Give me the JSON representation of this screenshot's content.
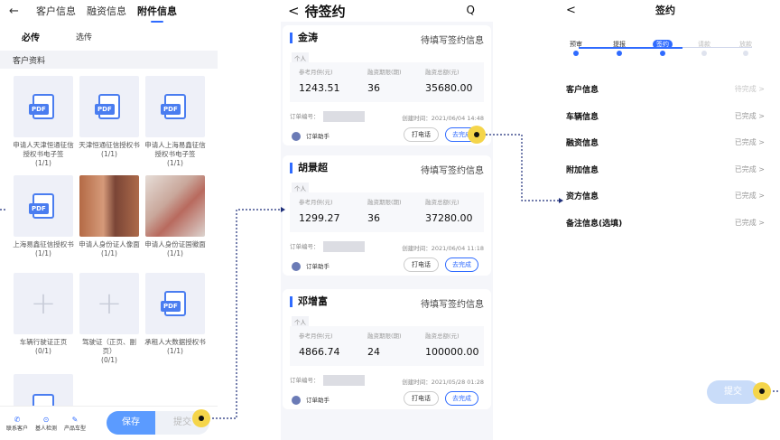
{
  "panel1": {
    "back": "←",
    "tabs": [
      "客户信息",
      "融资信息",
      "附件信息"
    ],
    "sub_tabs": [
      "必传",
      "选传"
    ],
    "section": "客户资料",
    "items": [
      {
        "label": "申请人天津恒通征信授权书电子签",
        "count": "(1/1)"
      },
      {
        "label": "天津恒通征信授权书",
        "count": "(1/1)"
      },
      {
        "label": "申请人上海易鑫征信授权书电子签",
        "count": "(1/1)"
      },
      {
        "label": "上海易鑫征信授权书",
        "count": "(1/1)"
      },
      {
        "label": "申请人身份证人像面",
        "count": "(1/1)"
      },
      {
        "label": "申请人身份证国徽面",
        "count": "(1/1)"
      },
      {
        "label": "车辆行驶证正页",
        "count": "(0/1)"
      },
      {
        "label": "驾驶证（正页、副页）",
        "count": "(0/1)"
      },
      {
        "label": "承租人大数据授权书",
        "count": "(1/1)"
      }
    ],
    "pdf_label": "PDF",
    "bottom": {
      "icons": [
        {
          "icon": "✆",
          "label": "联系客户"
        },
        {
          "icon": "⊙",
          "label": "基人检测"
        },
        {
          "icon": "✎",
          "label": "产品车型"
        }
      ],
      "save": "保存",
      "submit": "提交"
    }
  },
  "panel2": {
    "back": "<",
    "title": "待签约",
    "search_icon": "Q",
    "columns": [
      "参考月供(元)",
      "融资期限(期)",
      "融资总额(元)"
    ],
    "order_label": "订单编号：",
    "agent": "订单助手",
    "call": "打电话",
    "go": "去完成",
    "cards": [
      {
        "name": "金涛",
        "status": "待填写签约信息",
        "type": "个人",
        "monthly": "1243.51",
        "term": "36",
        "total": "35680.00",
        "time": "创建时间：2021/06/04 14:48"
      },
      {
        "name": "胡景超",
        "status": "待填写签约信息",
        "type": "个人",
        "monthly": "1299.27",
        "term": "36",
        "total": "37280.00",
        "time": "创建时间：2021/06/04 11:18"
      },
      {
        "name": "邓增富",
        "status": "待填写签约信息",
        "type": "个人",
        "monthly": "4866.74",
        "term": "24",
        "total": "100000.00",
        "time": "创建时间：2021/05/28 01:28"
      }
    ]
  },
  "panel3": {
    "back": "<",
    "title": "签约",
    "steps": [
      "预审",
      "提报",
      "签约",
      "请款",
      "放款"
    ],
    "active_step": 2,
    "rows": [
      {
        "name": "客户信息",
        "status": "待完成"
      },
      {
        "name": "车辆信息",
        "status": "已完成"
      },
      {
        "name": "融资信息",
        "status": "已完成"
      },
      {
        "name": "附加信息",
        "status": "已完成"
      },
      {
        "name": "资方信息",
        "status": "已完成"
      },
      {
        "name": "备注信息(选填)",
        "status": "已完成"
      }
    ],
    "arrow": ">",
    "submit": "提交"
  },
  "colors": {
    "accent": "#2f6bff",
    "highlight": "#f5d54a",
    "connector": "#1f2f7a"
  }
}
